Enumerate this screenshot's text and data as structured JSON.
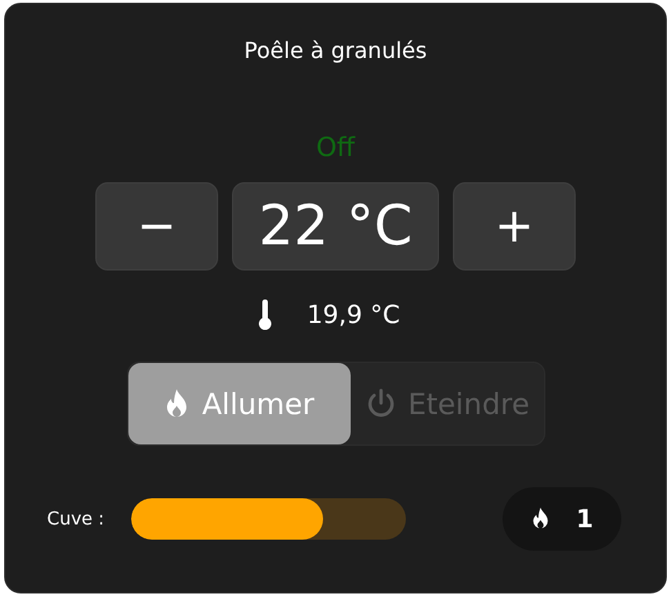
{
  "title": "Poêle à granulés",
  "status": "Off",
  "setpoint": {
    "decrease": "−",
    "value": "22 °C",
    "increase": "+"
  },
  "current_temperature": "19,9 °C",
  "modes": [
    {
      "label": "Allumer",
      "kind": "flame",
      "selected": true
    },
    {
      "label": "Eteindre",
      "kind": "power",
      "selected": false
    }
  ],
  "tank": {
    "label": "Cuve :",
    "level": 0.7
  },
  "power_badge": {
    "value": "1"
  }
}
